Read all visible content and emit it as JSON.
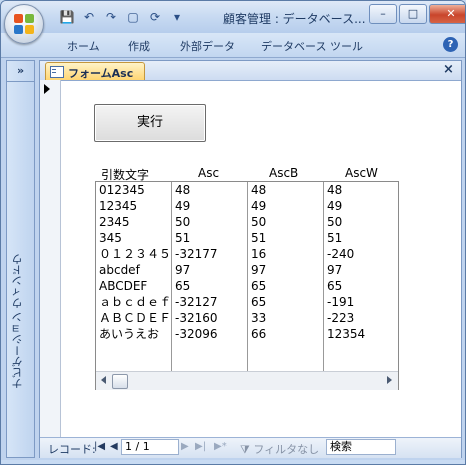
{
  "app": {
    "title": "顧客管理 : データベース..."
  },
  "quick_access": [
    {
      "icon": "save-icon",
      "glyph": "💾"
    },
    {
      "icon": "undo-icon",
      "glyph": "↶"
    },
    {
      "icon": "redo-icon",
      "glyph": "↷"
    },
    {
      "icon": "new-document-icon",
      "glyph": "▢"
    },
    {
      "icon": "refresh-icon",
      "glyph": "⟳"
    },
    {
      "icon": "customize-dropdown-icon",
      "glyph": "▾"
    }
  ],
  "window_controls": {
    "minimize": "–",
    "maximize": "□",
    "close": "✕"
  },
  "ribbon": {
    "tabs": [
      "ホーム",
      "作成",
      "外部データ",
      "データベース ツール"
    ],
    "help": "?"
  },
  "nav_pane": {
    "toggle": "»",
    "label": "ナビゲーション ウィンドウ"
  },
  "document_tab": {
    "label": "フォームAsc",
    "close": "×"
  },
  "form": {
    "run_button": "実行",
    "columns": [
      "引数文字",
      "Asc",
      "AscB",
      "AscW"
    ],
    "rows": [
      [
        "012345",
        "48",
        "48",
        "48"
      ],
      [
        "12345",
        "49",
        "49",
        "49"
      ],
      [
        "2345",
        "50",
        "50",
        "50"
      ],
      [
        "345",
        "51",
        "51",
        "51"
      ],
      [
        "０１２３４５",
        "-32177",
        "16",
        "-240"
      ],
      [
        "abcdef",
        "97",
        "97",
        "97"
      ],
      [
        "ABCDEF",
        "65",
        "65",
        "65"
      ],
      [
        "ａｂｃｄｅｆ",
        "-32127",
        "65",
        "-191"
      ],
      [
        "ＡＢＣＤＥＦ",
        "-32160",
        "33",
        "-223"
      ],
      [
        "あいうえお",
        "-32096",
        "66",
        "12354"
      ]
    ]
  },
  "record_nav": {
    "label": "レコード:",
    "first": "|◀",
    "prev": "◀",
    "position": "1 / 1",
    "next": "▶",
    "last": "▶|",
    "new": "▶*",
    "filter": "フィルタなし",
    "search": "検索"
  }
}
